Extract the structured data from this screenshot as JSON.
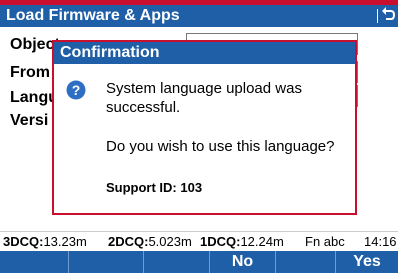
{
  "window": {
    "title": "Load Firmware & Apps"
  },
  "form": {
    "labels": [
      "Object",
      "From",
      "Langu",
      "Versi"
    ]
  },
  "dialog": {
    "title": "Confirmation",
    "message": "System language upload was successful.",
    "question": "Do you wish to use this language?",
    "support_id": "Support ID: 103",
    "icon": "question-icon"
  },
  "status": {
    "dcq3_label": "3DCQ:",
    "dcq3_value": "13.23m",
    "dcq2_label": "2DCQ:",
    "dcq2_value": "5.023m",
    "dcq1_label": "1DCQ:",
    "dcq1_value": "12.24m",
    "mode": "Fn abc",
    "time": "14:16"
  },
  "softkeys": {
    "no_label": "No",
    "yes_label": "Yes"
  },
  "colors": {
    "accent": "#1f5fa8",
    "border": "#c8102e"
  }
}
